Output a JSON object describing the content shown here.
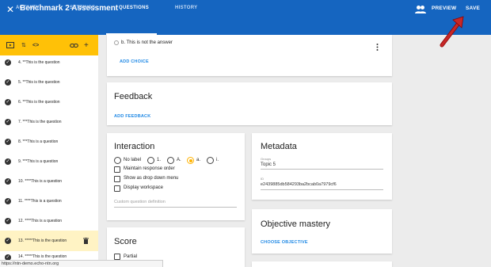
{
  "header": {
    "title": "Benchmark 2 Assessment",
    "preview_label": "PREVIEW",
    "save_label": "SAVE",
    "close_icon": "close-icon",
    "people_icon": "people-icon"
  },
  "tabs": [
    {
      "label": "ACTIVITY"
    },
    {
      "label": "SETTINGS"
    },
    {
      "label": "QUESTIONS"
    },
    {
      "label": "HISTORY"
    }
  ],
  "sidebar": {
    "toolbar_icons": [
      "preview-icon",
      "sort-icon",
      "code-icon",
      "link-icon",
      "add-icon"
    ],
    "items": [
      {
        "label": "4. **This is the question"
      },
      {
        "label": "5. **This is the question"
      },
      {
        "label": "6. **This is the question"
      },
      {
        "label": "7. ***This is the question"
      },
      {
        "label": "8. ***This is a question"
      },
      {
        "label": "9. ***This is a question"
      },
      {
        "label": "10. ****This is a question"
      },
      {
        "label": "11. ****This is a question"
      },
      {
        "label": "12. ****This is a question"
      },
      {
        "label": "13. *****This is the question"
      },
      {
        "label": "14. *****This is the question"
      }
    ]
  },
  "choice_card": {
    "choice_text": "b. This is not the answer",
    "add_choice_label": "ADD CHOICE"
  },
  "feedback_card": {
    "title": "Feedback",
    "add_feedback_label": "ADD FEEDBACK"
  },
  "interaction_card": {
    "title": "Interaction",
    "radio_options": [
      "No label",
      "1.",
      "A.",
      "a.",
      "i."
    ],
    "selected_option": "a.",
    "checkboxes": [
      "Maintain response order",
      "Show as drop down menu",
      "Display workspace"
    ],
    "custom_placeholder": "Custom question definition"
  },
  "metadata_card": {
    "title": "Metadata",
    "groups_label": "Groups",
    "groups_value": "Topic 5",
    "id_label": "ID",
    "id_value": "e2439885db584293ba2bcab0a7979cf6"
  },
  "objective_card": {
    "title": "Objective mastery",
    "choose_label": "CHOOSE OBJECTIVE"
  },
  "score_card": {
    "title": "Score",
    "partial_label": "Partial"
  },
  "status_bar": {
    "url": "https://ntn-demo.echo-ntn.org"
  },
  "colors": {
    "primary": "#1565c0",
    "accent": "#ffc107",
    "link": "#1e88e5",
    "arrow": "#c62828"
  }
}
